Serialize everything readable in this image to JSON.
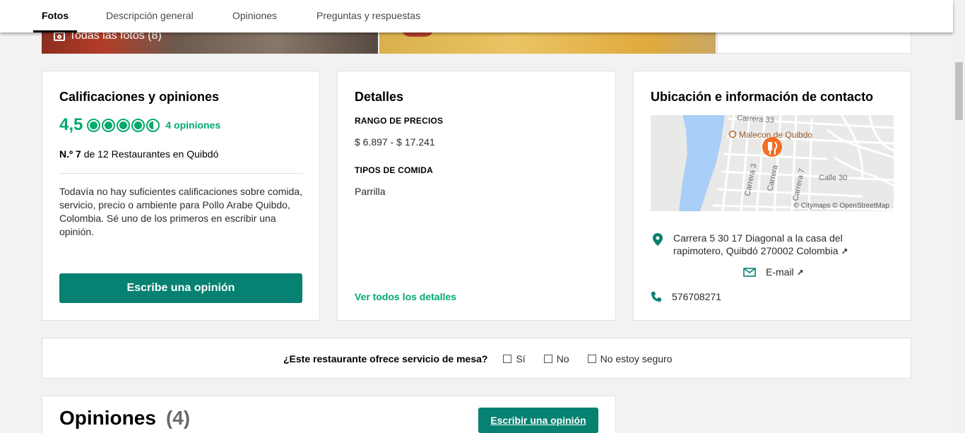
{
  "tabs": [
    "Fotos",
    "Descripción general",
    "Opiniones",
    "Preguntas y respuestas"
  ],
  "photos": {
    "all_label": "Todas las fotos (8)"
  },
  "ratings": {
    "title": "Calificaciones y opiniones",
    "score": "4,5",
    "bubble_rating": 4.5,
    "reviews_link": "4 opiniones",
    "rank_prefix": "N.º 7",
    "rank_suffix": "de 12 Restaurantes en Quibdó",
    "note": "Todavía no hay suficientes calificaciones sobre comida, servicio, precio o ambiente para Pollo Arabe Quibdo, Colombia. Sé uno de los primeros en escribir una opinión.",
    "write_button": "Escribe una opinión"
  },
  "details": {
    "title": "Detalles",
    "price_label": "RANGO DE PRECIOS",
    "price_value": "$ 6.897 - $ 17.241",
    "cuisine_label": "TIPOS DE COMIDA",
    "cuisine_value": "Parrilla",
    "all_details_link": "Ver todos los detalles"
  },
  "location": {
    "title": "Ubicación e información de contacto",
    "map_labels": {
      "poi": "Malecon de Quibdo",
      "street1": "Carrera 33",
      "street2": "Carrera 3",
      "street3": "Carrera",
      "street4": "Carrera 7",
      "street5": "Calle 30",
      "attribution": "© Citymaps © OpenStreetMap"
    },
    "address": "Carrera 5 30 17 Diagonal a la casa del rapimotero, Quibdó 270002 Colombia",
    "email": "E-mail",
    "phone": "576708271"
  },
  "question": {
    "text": "¿Este restaurante ofrece servicio de mesa?",
    "options": [
      "Sí",
      "No",
      "No estoy seguro"
    ]
  },
  "reviews": {
    "title": "Opiniones",
    "count": "(4)",
    "write_button": "Escribir una opinión"
  },
  "colors": {
    "brand_green": "#00aa6c",
    "button_green": "#078171"
  }
}
